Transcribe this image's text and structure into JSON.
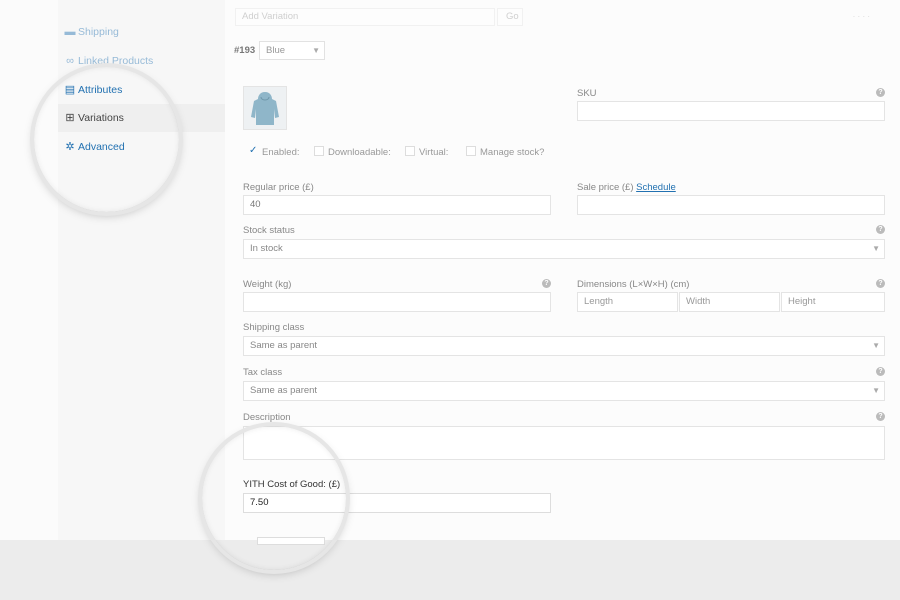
{
  "sidebar": {
    "items": [
      {
        "label": "Shipping",
        "icon": "truck-icon"
      },
      {
        "label": "Linked Products",
        "icon": "link-icon"
      },
      {
        "label": "Attributes",
        "icon": "attributes-icon"
      },
      {
        "label": "Variations",
        "icon": "grid-icon"
      },
      {
        "label": "Advanced",
        "icon": "gear-icon"
      }
    ]
  },
  "top": {
    "add_variation": "Add Variation",
    "go_label": "Go",
    "variation_id": "#193",
    "variation_value": "Blue"
  },
  "form": {
    "sku_label": "SKU",
    "enabled_label": "Enabled:",
    "downloadable_label": "Downloadable:",
    "virtual_label": "Virtual:",
    "manage_stock_label": "Manage stock?",
    "regular_price_label": "Regular price (£)",
    "regular_price_value": "40",
    "sale_price_label": "Sale price (£)",
    "schedule_link": "Schedule",
    "stock_status_label": "Stock status",
    "stock_status_value": "In stock",
    "weight_label": "Weight (kg)",
    "dimensions_label": "Dimensions (L×W×H) (cm)",
    "length_placeholder": "Length",
    "width_placeholder": "Width",
    "height_placeholder": "Height",
    "shipping_class_label": "Shipping class",
    "shipping_class_value": "Same as parent",
    "tax_class_label": "Tax class",
    "tax_class_value": "Same as parent",
    "description_label": "Description",
    "cost_label": "YITH Cost of Good: (£)",
    "cost_value": "7.50"
  },
  "colors": {
    "accent": "#2271b1",
    "hoodie": "#8fb6c9"
  }
}
